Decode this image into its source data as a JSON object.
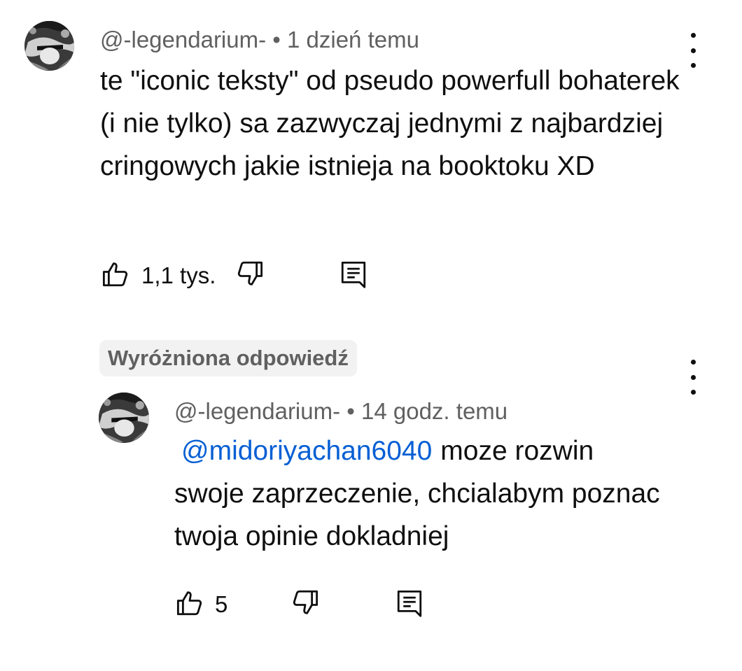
{
  "comment": {
    "author": "@-legendarium-",
    "separator": "•",
    "timestamp": "1 dzień temu",
    "text": "te \"iconic teksty\" od pseudo powerfull bohaterek (i nie tylko) sa zazwyczaj jednymi z najbardziej cringowych jakie istnieja na booktoku XD",
    "like_count": "1,1 tys.",
    "icons": {
      "like": "thumbs-up-icon",
      "dislike": "thumbs-down-icon",
      "reply": "reply-comment-icon",
      "more": "more-vertical-icon"
    }
  },
  "reply": {
    "badge": "Wyróżniona odpowiedź",
    "author": "@-legendarium-",
    "separator": "•",
    "timestamp": "14 godz. temu",
    "mention": "@midoriyachan6040",
    "text": "moze rozwin swoje zaprzeczenie, chcialabym poznac twoja opinie dokladniej",
    "like_count": "5"
  },
  "colors": {
    "text": "#0f0f0f",
    "secondary": "#606060",
    "mention": "#065fd4",
    "badge_bg": "#f2f2f2"
  }
}
